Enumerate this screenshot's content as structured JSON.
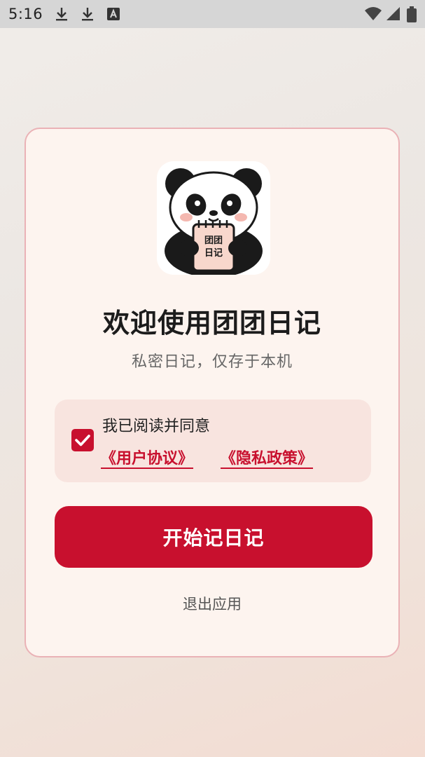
{
  "status_bar": {
    "time": "5:16",
    "icons": [
      "download-icon",
      "download-icon",
      "keyboard-a-icon",
      "wifi-icon",
      "signal-icon",
      "battery-icon"
    ]
  },
  "welcome": {
    "logo_text_line1": "团团",
    "logo_text_line2": "日记",
    "title": "欢迎使用团团日记",
    "subtitle": "私密日记，仅存于本机"
  },
  "agreement": {
    "checked": true,
    "text": "我已阅读并同意",
    "user_agreement": "《用户协议》",
    "privacy_policy": "《隐私政策》"
  },
  "actions": {
    "start_label": "开始记日记",
    "exit_label": "退出应用"
  },
  "colors": {
    "accent": "#c8102e",
    "card_bg": "#fdf4ef",
    "card_border": "#eab2b6",
    "agree_bg": "#f8e4df"
  }
}
